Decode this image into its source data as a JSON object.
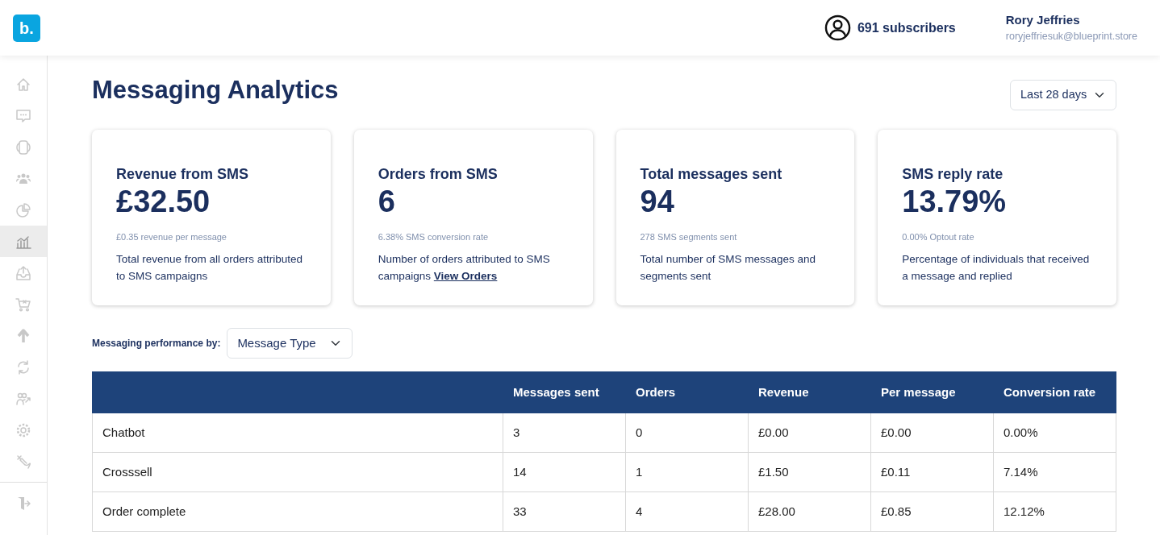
{
  "header": {
    "subscribers": "691 subscribers",
    "user_name": "Rory Jeffries",
    "user_email": "roryjeffriesuk@blueprint.store",
    "logo": "b."
  },
  "sidebar": {
    "items": [
      {
        "selected": false
      },
      {
        "selected": false
      },
      {
        "selected": false
      },
      {
        "selected": false
      },
      {
        "selected": false
      },
      {
        "selected": true
      },
      {
        "selected": false
      },
      {
        "selected": false
      },
      {
        "selected": false
      },
      {
        "selected": false
      },
      {
        "selected": false
      },
      {
        "selected": false
      },
      {
        "selected": false
      }
    ]
  },
  "page": {
    "title": "Messaging Analytics",
    "period": "Last 28 days"
  },
  "cards": [
    {
      "title": "Revenue from SMS",
      "value": "£32.50",
      "sub": "£0.35 revenue per message",
      "description": "Total revenue from all orders attributed to SMS campaigns"
    },
    {
      "title": "Orders from SMS",
      "value": "6",
      "sub": "6.38% SMS conversion rate",
      "description": "Number of orders attributed to SMS campaigns",
      "link": "View Orders"
    },
    {
      "title": "Total messages sent",
      "value": "94",
      "sub": "278 SMS segments sent",
      "description": "Total number of SMS messages and segments sent"
    },
    {
      "title": "SMS reply rate",
      "value": "13.79%",
      "sub": "0.00% Optout rate",
      "description": "Percentage of individuals that received a message and replied"
    }
  ],
  "performance": {
    "label": "Messaging performance by:",
    "value": "Message Type"
  },
  "table": {
    "columns": [
      "",
      "Messages sent",
      "Orders",
      "Revenue",
      "Per message",
      "Conversion rate"
    ],
    "rows": [
      [
        "Chatbot",
        "3",
        "0",
        "£0.00",
        "£0.00",
        "0.00%"
      ],
      [
        "Crosssell",
        "14",
        "1",
        "£1.50",
        "£0.11",
        "7.14%"
      ],
      [
        "Order complete",
        "33",
        "4",
        "£28.00",
        "£0.85",
        "12.12%"
      ]
    ]
  }
}
